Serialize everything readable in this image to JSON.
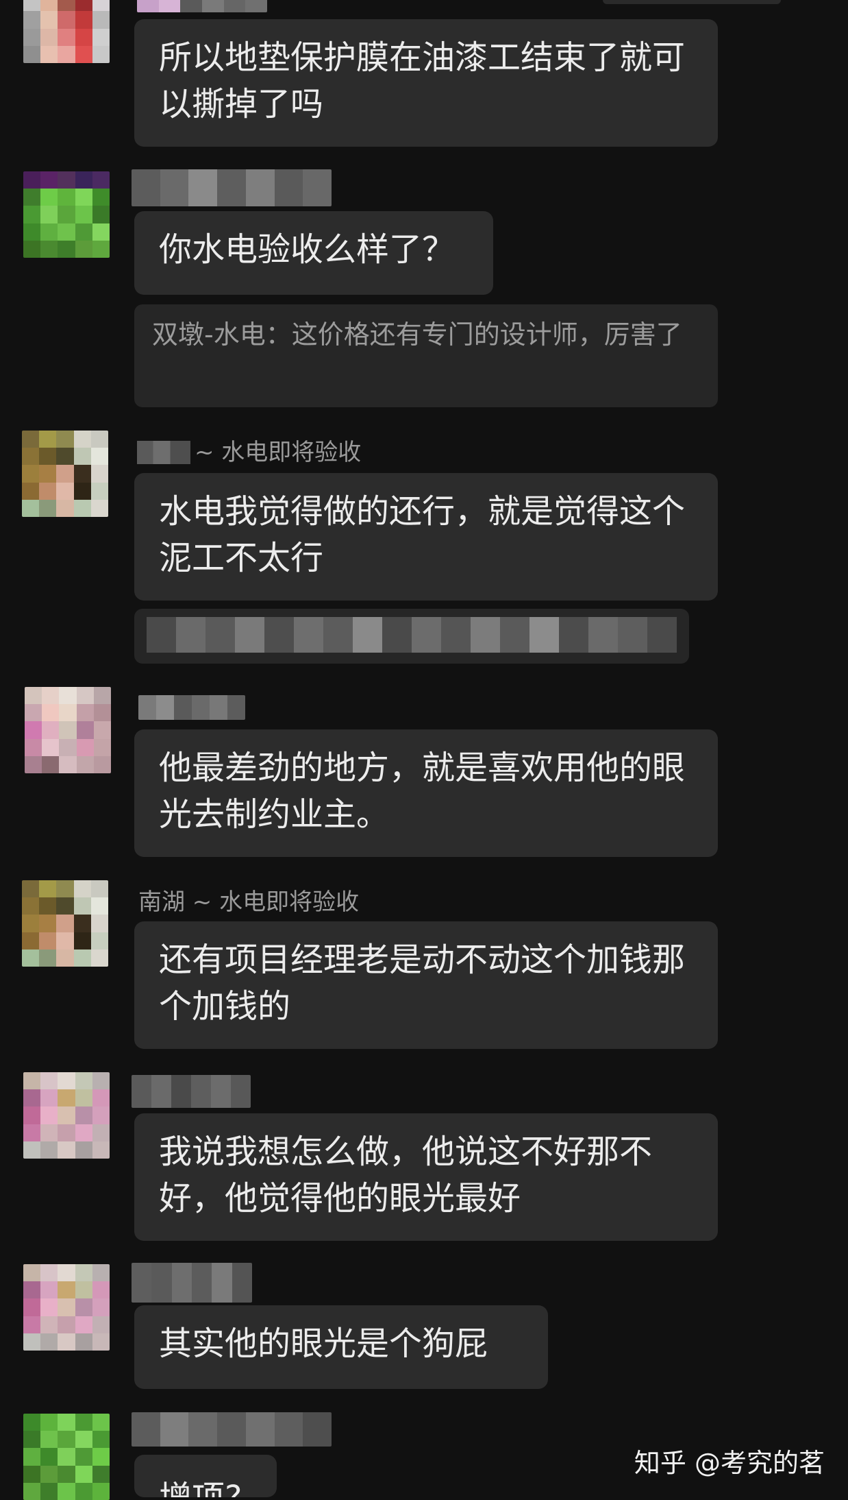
{
  "messages": [
    {
      "text": "所以地垫保护膜在油漆工结束了就可以撕掉了吗"
    },
    {
      "text": "你水电验收么样了？"
    },
    {
      "quote": "双墩-水电：这价格还有专门的设计师，厉害了"
    },
    {
      "sender_suffix": "~ 水电即将验收",
      "text": "水电我觉得做的还行，就是觉得这个泥工不太行"
    },
    {
      "text": "他最差劲的地方，就是喜欢用他的眼光去制约业主。"
    },
    {
      "sender": "南湖 ~ 水电即将验收",
      "text": "还有项目经理老是动不动这个加钱那个加钱的"
    },
    {
      "text": "我说我想怎么做，他说这不好那不好，他觉得他的眼光最好"
    },
    {
      "text": "其实他的眼光是个狗屁"
    },
    {
      "text": "增项?"
    }
  ],
  "watermark": "知乎 @考究的茗",
  "colors": {
    "background": "#111111",
    "bubble": "#2c2c2c",
    "quote_bubble": "#262626",
    "text": "#ececec",
    "meta_text": "#9a9a9a"
  },
  "icons": [
    "avatar-pixelated",
    "name-pixelated"
  ]
}
